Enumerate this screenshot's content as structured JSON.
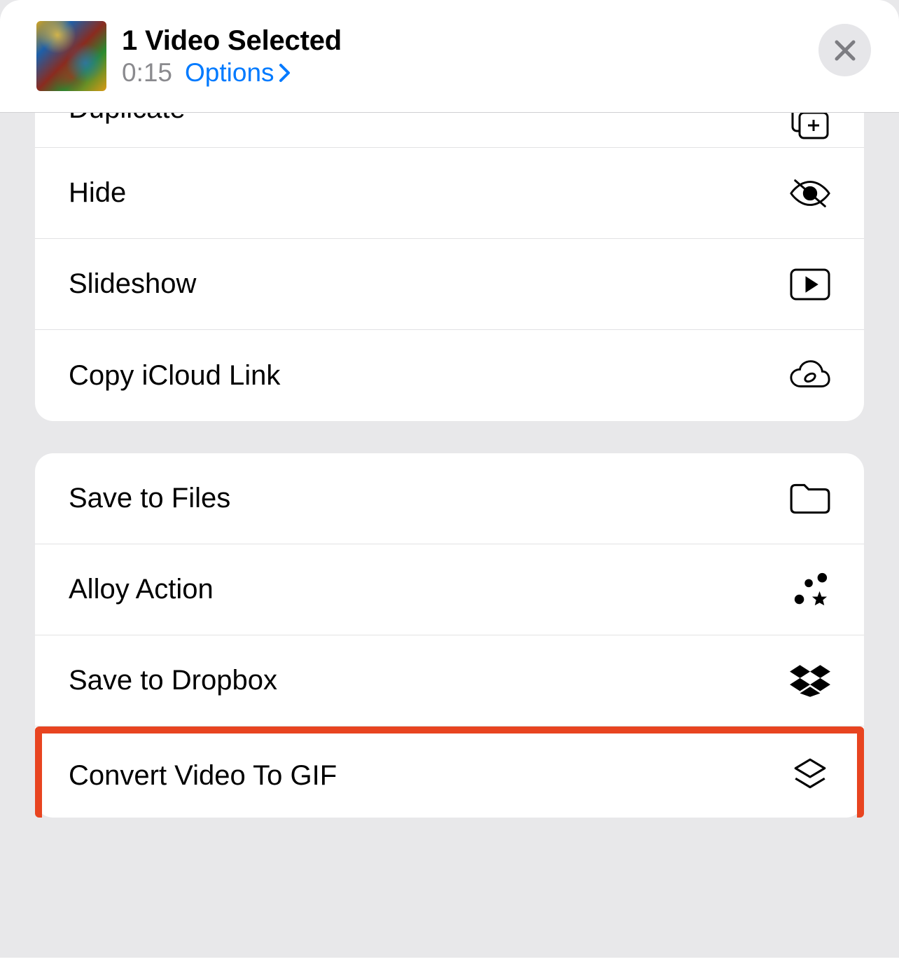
{
  "header": {
    "title": "1 Video Selected",
    "duration": "0:15",
    "options_label": "Options"
  },
  "groups": [
    {
      "rows": [
        {
          "label": "Duplicate",
          "icon": "duplicate"
        },
        {
          "label": "Hide",
          "icon": "hide"
        },
        {
          "label": "Slideshow",
          "icon": "play"
        },
        {
          "label": "Copy iCloud Link",
          "icon": "cloud-link"
        }
      ]
    },
    {
      "rows": [
        {
          "label": "Save to Files",
          "icon": "folder"
        },
        {
          "label": "Alloy Action",
          "icon": "alloy"
        },
        {
          "label": "Save to Dropbox",
          "icon": "dropbox"
        },
        {
          "label": "Convert Video To GIF",
          "icon": "layers",
          "highlighted": true
        }
      ]
    }
  ]
}
